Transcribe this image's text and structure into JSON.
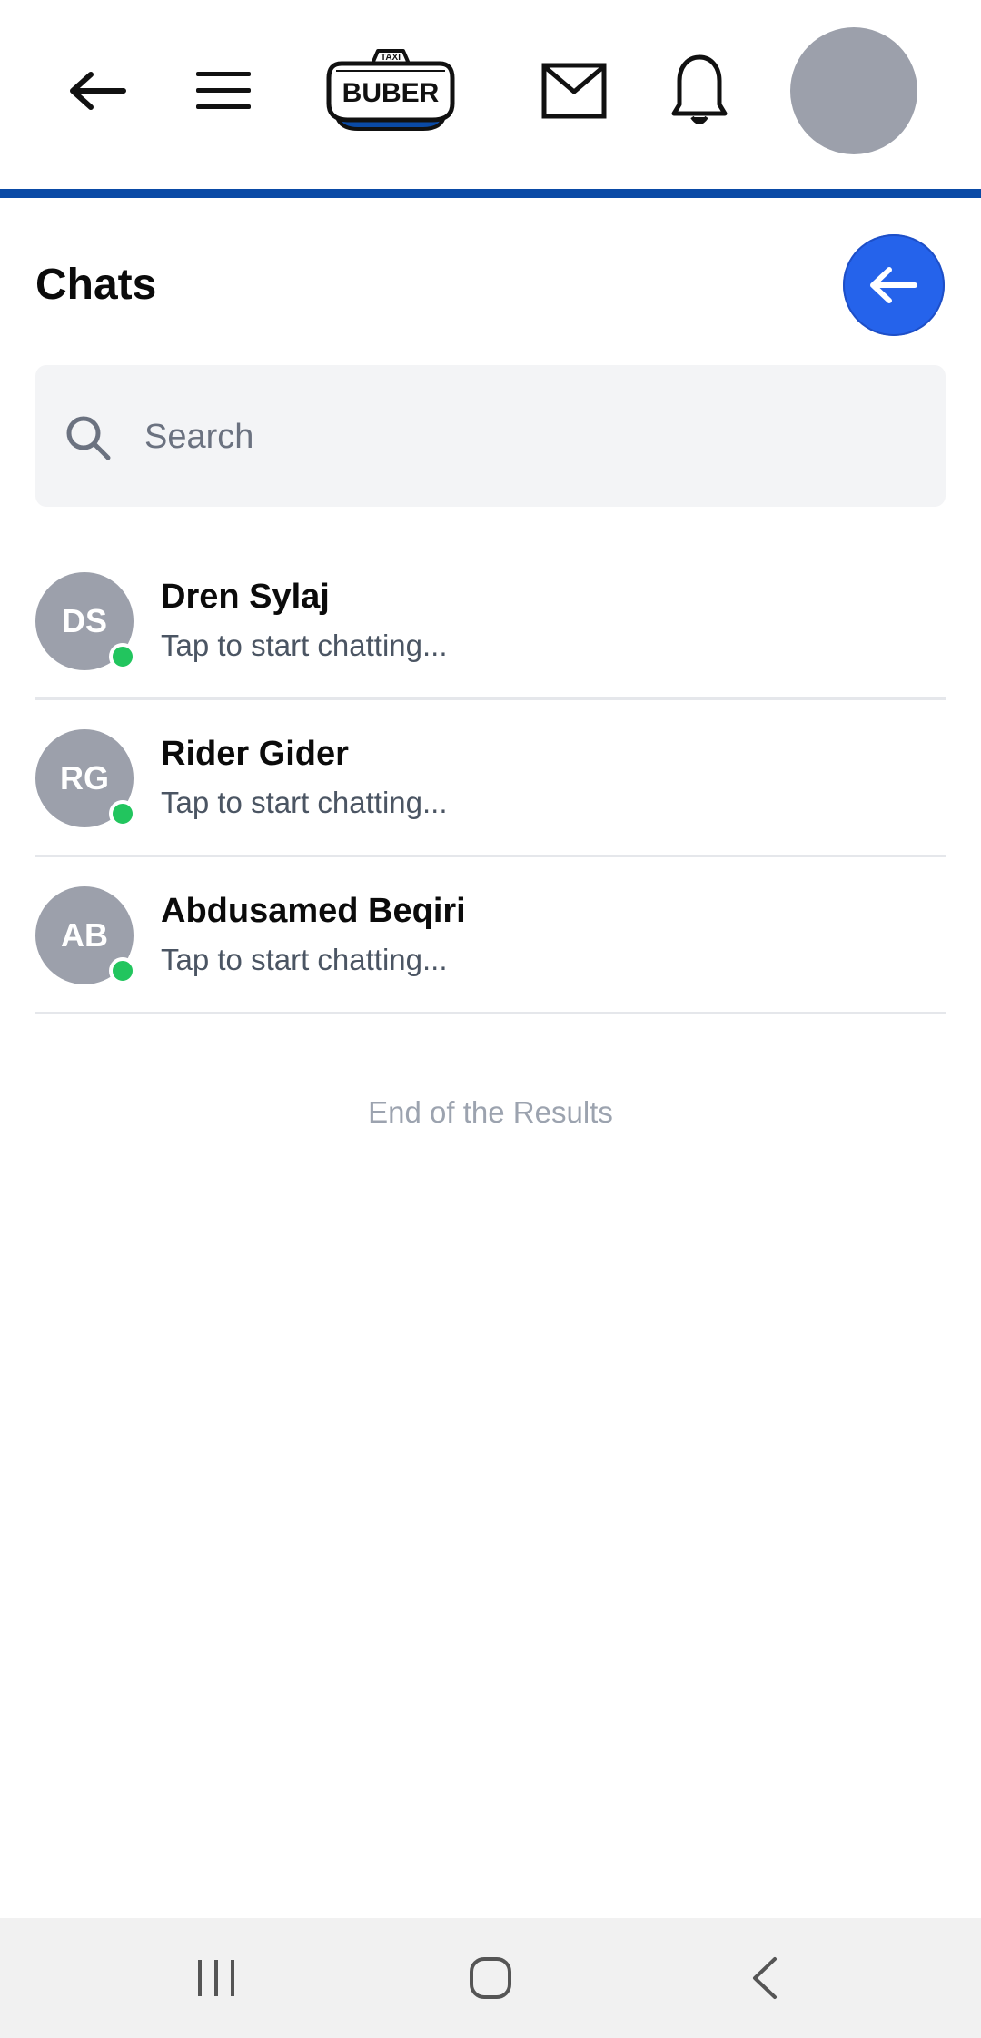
{
  "top_bar": {
    "back_icon": "arrow-left-icon",
    "menu_icon": "hamburger-menu-icon",
    "logo": {
      "badge_text": "TAXI",
      "wordmark": "BUBER",
      "accent_color": "#0a4aa6"
    },
    "mail_icon": "mail-icon",
    "notification_icon": "bell-icon",
    "avatar_color": "#9ca0ab"
  },
  "chats": {
    "title": "Chats",
    "back_button_icon": "arrow-left-icon",
    "back_button_color": "#2563eb"
  },
  "search": {
    "placeholder": "Search",
    "value": "",
    "icon": "search-icon"
  },
  "chat_list": [
    {
      "initials": "DS",
      "name": "Dren Sylaj",
      "preview": "Tap to start chatting...",
      "online": true
    },
    {
      "initials": "RG",
      "name": "Rider Gider",
      "preview": "Tap to start chatting...",
      "online": true
    },
    {
      "initials": "AB",
      "name": "Abdusamed Beqiri",
      "preview": "Tap to start chatting...",
      "online": true
    }
  ],
  "end_of_results": "End of the Results",
  "status_colors": {
    "online": "#22c55e"
  },
  "system_nav": {
    "recents_icon": "recents-icon",
    "home_icon": "home-icon",
    "back_icon": "back-chevron-icon"
  }
}
